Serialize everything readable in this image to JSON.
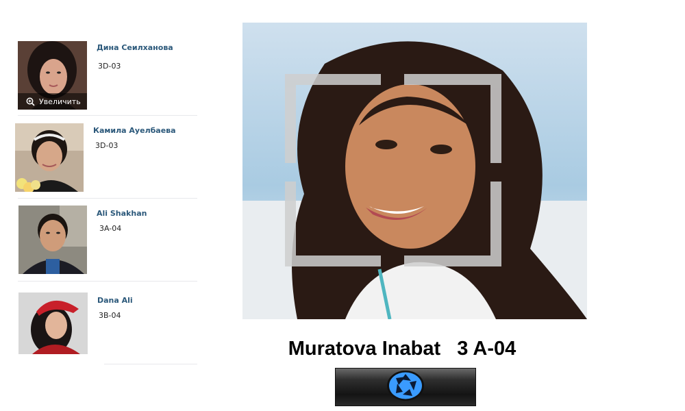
{
  "students": [
    {
      "name": "Дина Сеилханова",
      "group": "3D-03",
      "zoom_label": "Увеличить"
    },
    {
      "name": "Камила Ауелбаева",
      "group": "3D-03"
    },
    {
      "name": "Ali Shakhan",
      "group": "3A-04"
    },
    {
      "name": "Dana Ali",
      "group": "3B-04"
    }
  ],
  "recognized": {
    "caption": "Muratova Inabat   3 A-04"
  },
  "icons": {
    "zoom": "magnifier-plus-icon",
    "capture": "camera-shutter-icon"
  },
  "colors": {
    "name_link": "#2b587a",
    "shutter": "#3a9bff"
  }
}
